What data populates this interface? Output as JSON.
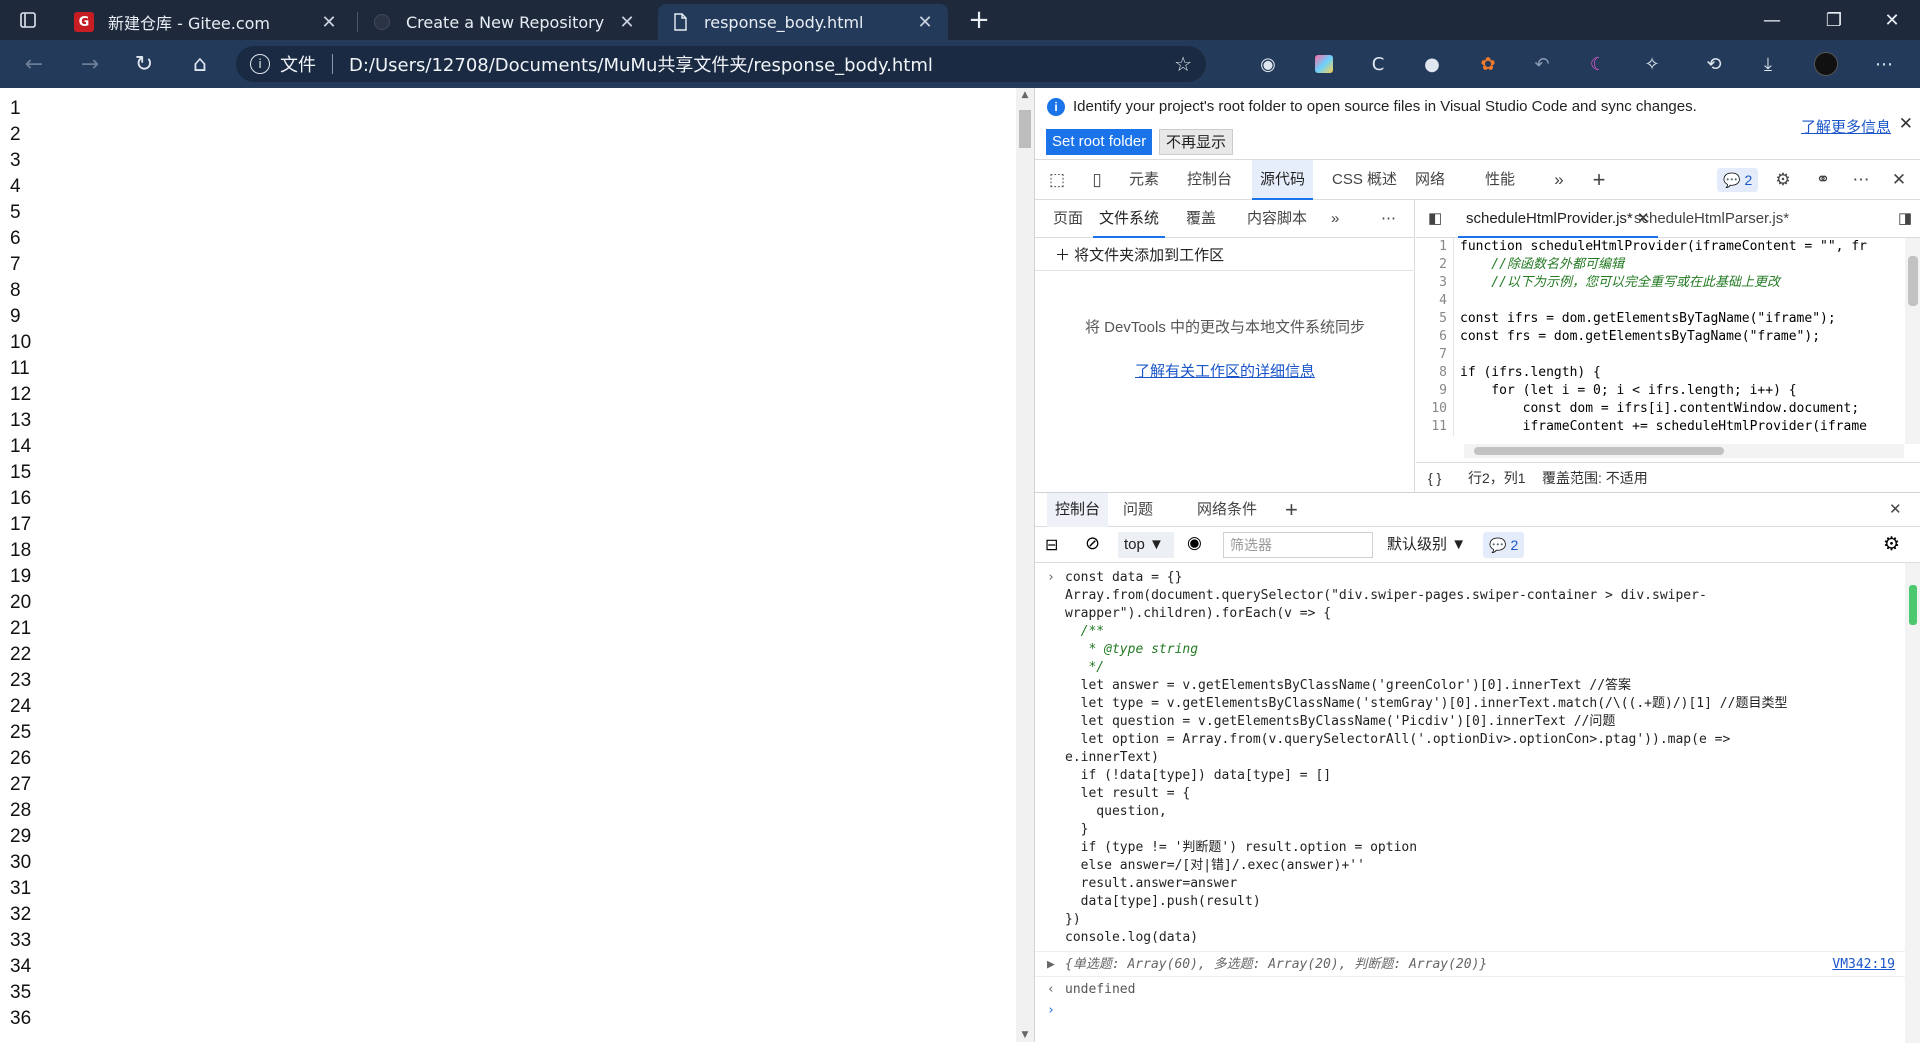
{
  "tabs": [
    {
      "title": "新建仓库 - Gitee.com",
      "icon": "gitee-logo",
      "active": false
    },
    {
      "title": "Create a New Repository",
      "icon": "github-logo",
      "active": false
    },
    {
      "title": "response_body.html",
      "icon": "file-icon",
      "active": true
    }
  ],
  "address": {
    "scheme_label": "文件",
    "url": "D:/Users/12708/Documents/MuMu共享文件夹/response_body.html"
  },
  "page": {
    "line_numbers": [
      "1",
      "2",
      "3",
      "4",
      "5",
      "6",
      "7",
      "8",
      "9",
      "10",
      "11",
      "12",
      "13",
      "14",
      "15",
      "16",
      "17",
      "18",
      "19",
      "20",
      "21",
      "22",
      "23",
      "24",
      "25",
      "26",
      "27",
      "28",
      "29",
      "30",
      "31",
      "32",
      "33",
      "34",
      "35",
      "36"
    ]
  },
  "devtools": {
    "infobar": {
      "message": "Identify your project's root folder to open source files in Visual Studio Code and sync changes.",
      "set_root": "Set root folder",
      "dismiss": "不再显示",
      "learn_more": "了解更多信息"
    },
    "main_tabs": [
      "元素",
      "控制台",
      "源代码",
      "CSS 概述",
      "网络",
      "性能"
    ],
    "issues_count": "2",
    "nav_tabs": [
      "页面",
      "文件系统",
      "覆盖",
      "内容脚本"
    ],
    "add_folder": "将文件夹添加到工作区",
    "sync_message": "将 DevTools 中的更改与本地文件系统同步",
    "workspace_link": "了解有关工作区的详细信息",
    "editor_tabs": [
      "scheduleHtmlProvider.js*",
      "scheduleHtmlParser.js*"
    ],
    "code_lines": [
      "function scheduleHtmlProvider(iframeContent = \"\", fr",
      "    //除函数名外都可编辑",
      "    //以下为示例，您可以完全重写或在此基础上更改",
      "",
      "const ifrs = dom.getElementsByTagName(\"iframe\");",
      "const frs = dom.getElementsByTagName(\"frame\");",
      "",
      "if (ifrs.length) {",
      "    for (let i = 0; i < ifrs.length; i++) {",
      "        const dom = ifrs[i].contentWindow.document;",
      "        iframeContent += scheduleHtmlProvider(iframe"
    ],
    "status_pos": "行2，列1",
    "status_coverage": "覆盖范围: 不适用",
    "drawer_tabs": [
      "控制台",
      "问题",
      "网络条件"
    ],
    "console_context": "top",
    "filter_placeholder": "筛选器",
    "log_level": "默认级别",
    "console_issues": "2",
    "console_input": [
      "const data = {}",
      "Array.from(document.querySelector(\"div.swiper-pages.swiper-container > div.swiper-",
      "wrapper\").children).forEach(v => {",
      "  /**",
      "   * @type string",
      "   */",
      "  let answer = v.getElementsByClassName('greenColor')[0].innerText //答案",
      "  let type = v.getElementsByClassName('stemGray')[0].innerText.match(/\\((.+题)/)[1] //题目类型",
      "  let question = v.getElementsByClassName('Picdiv')[0].innerText //问题",
      "  let option = Array.from(v.querySelectorAll('.optionDiv>.optionCon>.ptag')).map(e =>",
      "e.innerText)",
      "  if (!data[type]) data[type] = []",
      "  let result = {",
      "    question,",
      "  }",
      "  if (type != '判断题') result.option = option",
      "  else answer=/[对|错]/.exec(answer)+''",
      "  result.answer=answer",
      "  data[type].push(result)",
      "})",
      "console.log(data)"
    ],
    "console_output": "{单选题: Array(60), 多选题: Array(20), 判断题: Array(20)}",
    "console_output_source": "VM342:19",
    "console_return": "undefined"
  }
}
